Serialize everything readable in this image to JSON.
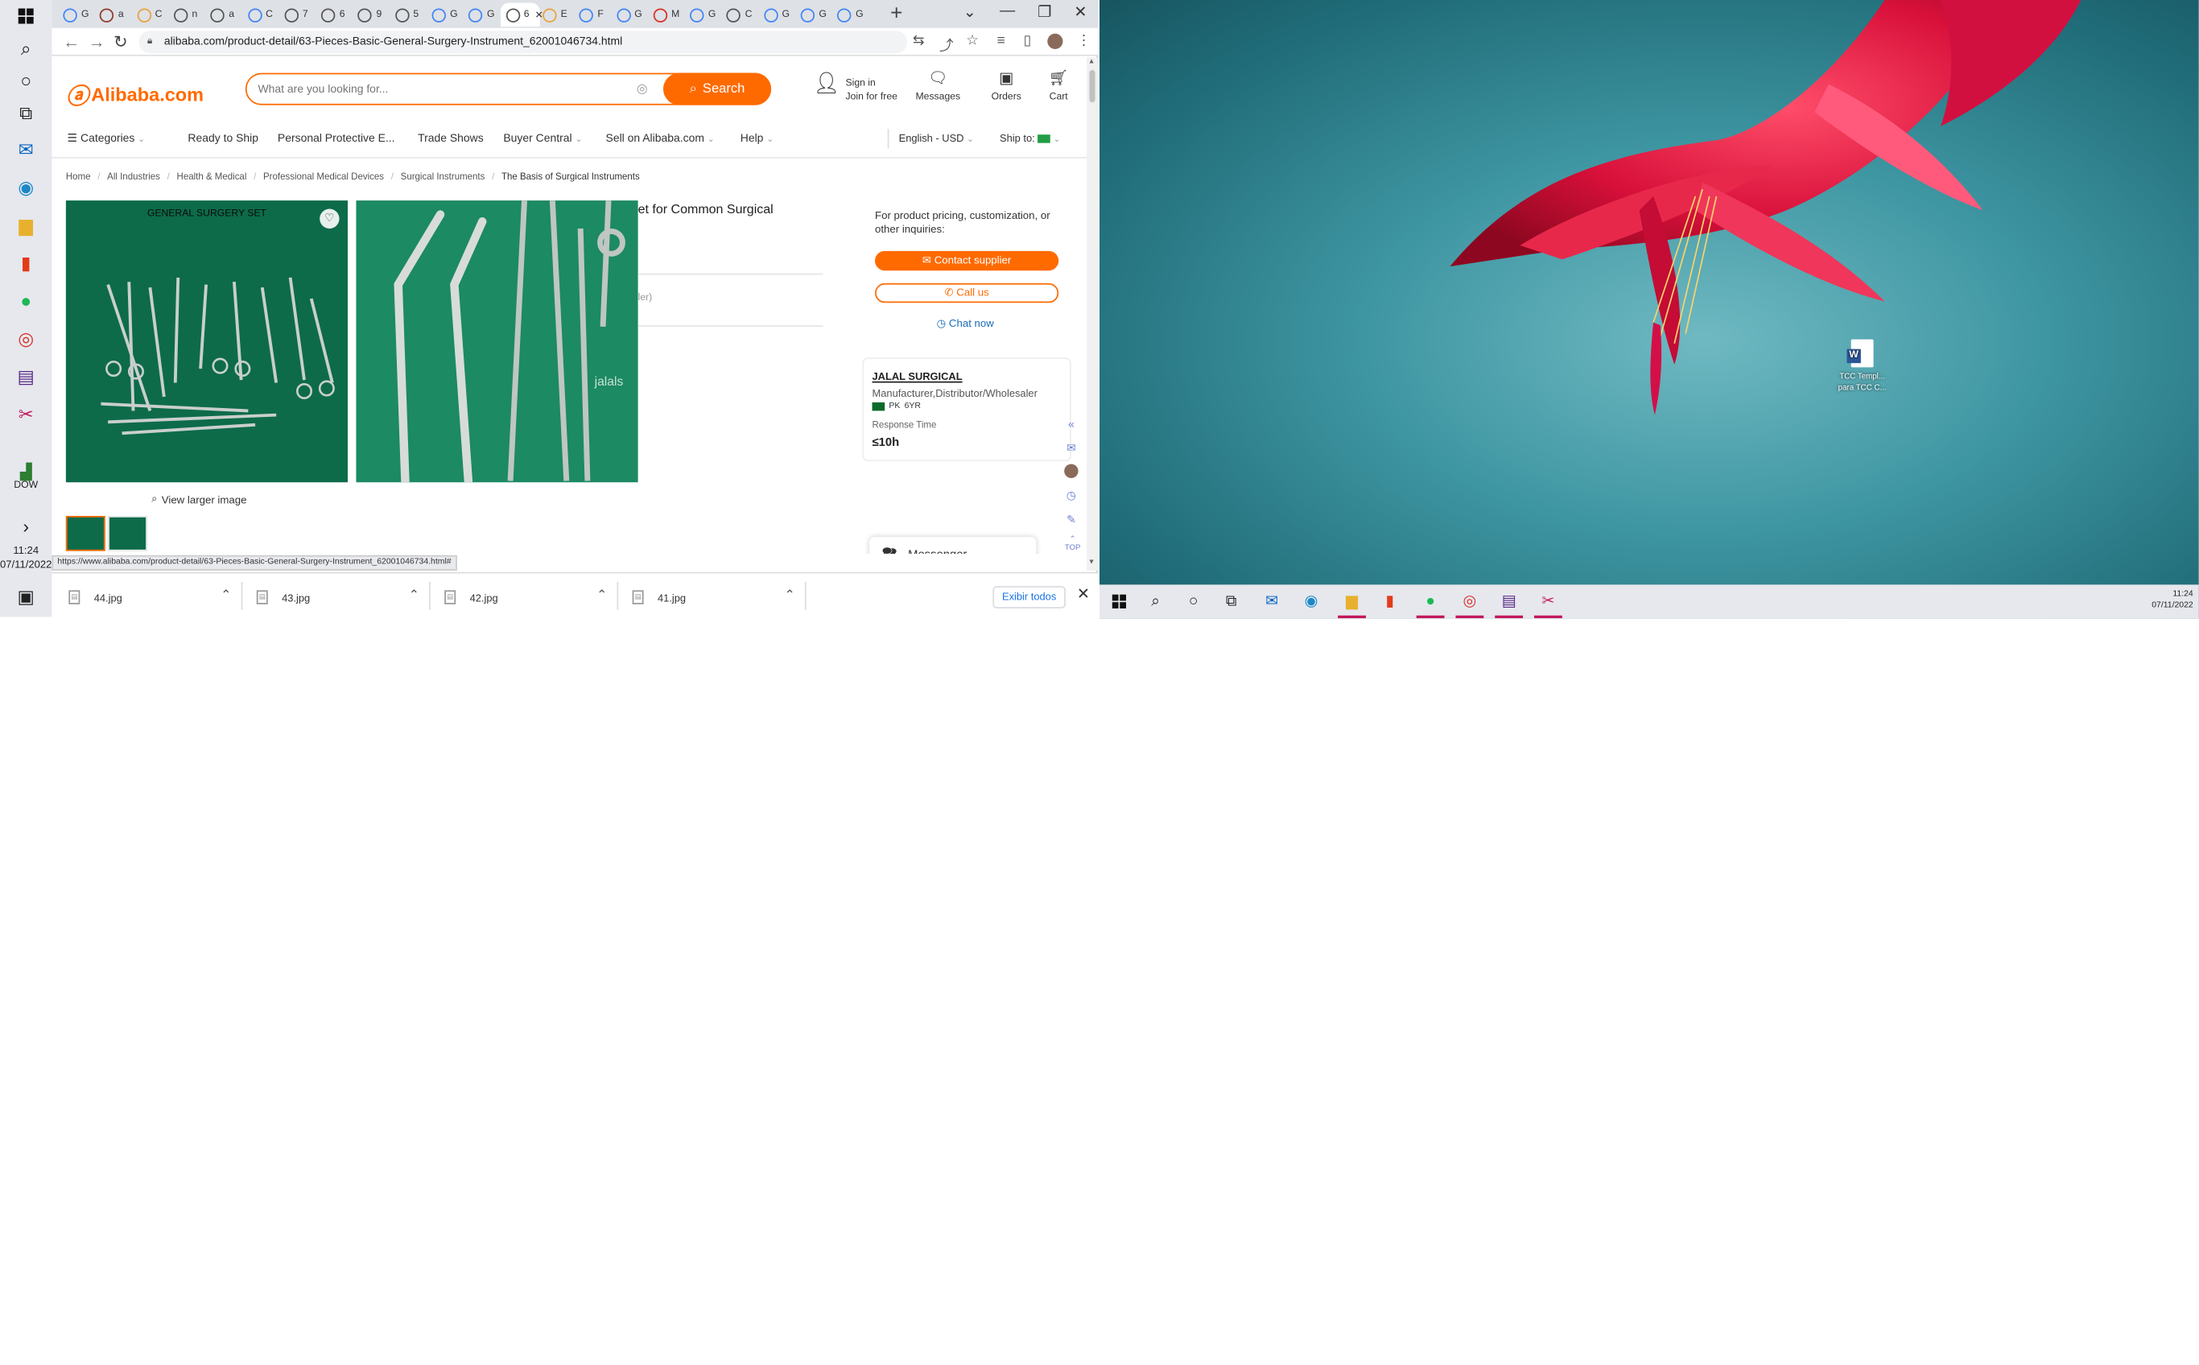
{
  "browser": {
    "url": "alibaba.com/product-detail/63-Pieces-Basic-General-Surgery-Instrument_62001046734.html",
    "status_url": "https://www.alibaba.com/product-detail/63-Pieces-Basic-General-Surgery-Instrument_62001046734.html#",
    "tabs": [
      "G",
      "a",
      "C",
      "n",
      "a",
      "C",
      "7",
      "6",
      "9",
      "5",
      "G",
      "G",
      "6",
      "E",
      "F",
      "G",
      "M",
      "G",
      "C",
      "G",
      "G",
      "G"
    ]
  },
  "site": {
    "logo": "Alibaba.com",
    "search_placeholder": "What are you looking for...",
    "search_button": "Search",
    "sign_in": "Sign in",
    "join": "Join for free",
    "messages": "Messages",
    "orders": "Orders",
    "cart": "Cart"
  },
  "catnav": {
    "categories": "Categories",
    "ready_to_ship": "Ready to Ship",
    "ppe": "Personal Protective E...",
    "trade_shows": "Trade Shows",
    "buyer_central": "Buyer Central",
    "sell": "Sell on Alibaba.com",
    "help": "Help",
    "language": "English - USD",
    "ship_to": "Ship to:"
  },
  "breadcrumb": [
    "Home",
    "All Industries",
    "Health & Medical",
    "Professional Medical Devices",
    "Surgical Instruments",
    "The Basis of Surgical Instruments"
  ],
  "product": {
    "image_caption": "GENERAL SURGERY SET",
    "watermark": "jalals",
    "title_fragment": "et for Common Surgical",
    "gray_fragment": "ler)",
    "view_larger": "View larger image"
  },
  "inquiry": {
    "text": "For product pricing, customization, or other inquiries:",
    "contact": "Contact supplier",
    "call": "Call us",
    "chat": "Chat now"
  },
  "supplier": {
    "name": "JALAL SURGICAL",
    "type": "Manufacturer,Distributor/Wholesaler",
    "country": "PK",
    "years": "6YR",
    "response_label": "Response Time",
    "response_value": "≤10h"
  },
  "side_tools_top": "TOP",
  "messenger": "Messenger",
  "downloads": {
    "files": [
      "44.jpg",
      "43.jpg",
      "42.jpg",
      "41.jpg"
    ],
    "show_all": "Exibir todos"
  },
  "left_taskbar": {
    "dow_label": "DOW",
    "time": "11:24",
    "date": "07/11/2022"
  },
  "desktop": {
    "icon_label_1": "TCC Templ...",
    "icon_label_2": "para TCC C..."
  },
  "right_taskbar": {
    "time": "11:24",
    "date": "07/11/2022"
  },
  "colors": {
    "accent": "#ff6a00",
    "link": "#1a6bb8"
  }
}
